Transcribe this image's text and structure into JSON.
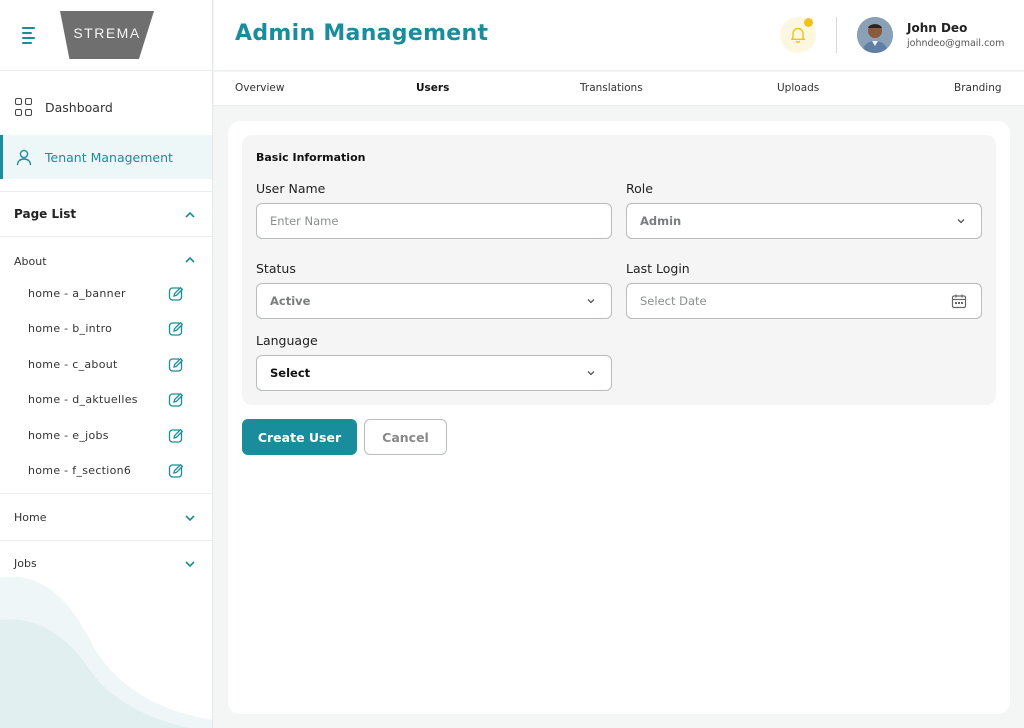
{
  "brand": {
    "logo_text": "STREMA",
    "accent": "#1a8d9c"
  },
  "sidebar": {
    "nav": [
      {
        "label": "Dashboard",
        "icon": "grid-icon"
      },
      {
        "label": "Tenant Management",
        "icon": "user-icon"
      }
    ],
    "page_list_title": "Page List",
    "sections": {
      "about": {
        "label": "About",
        "items": [
          "home - a_banner",
          "home - b_intro",
          "home - c_about",
          "home - d_aktuelles",
          "home - e_jobs",
          "home - f_section6"
        ]
      },
      "home": {
        "label": "Home"
      },
      "jobs": {
        "label": "Jobs"
      }
    }
  },
  "header": {
    "title": "Admin Management",
    "user": {
      "name": "John Deo",
      "email": "johndeo@gmail.com"
    },
    "notification_color": "#f2c21b"
  },
  "tabs": [
    "Overview",
    "Users",
    "Translations",
    "Uploads",
    "Branding"
  ],
  "active_tab": "Users",
  "form": {
    "section_title": "Basic Information",
    "user_name": {
      "label": "User Name",
      "placeholder": "Enter Name"
    },
    "role": {
      "label": "Role",
      "value": "Admin"
    },
    "status": {
      "label": "Status",
      "value": "Active"
    },
    "last_login": {
      "label": "Last Login",
      "placeholder": "Select Date"
    },
    "language": {
      "label": "Language",
      "value": "Select"
    }
  },
  "actions": {
    "create": "Create User",
    "cancel": "Cancel"
  }
}
